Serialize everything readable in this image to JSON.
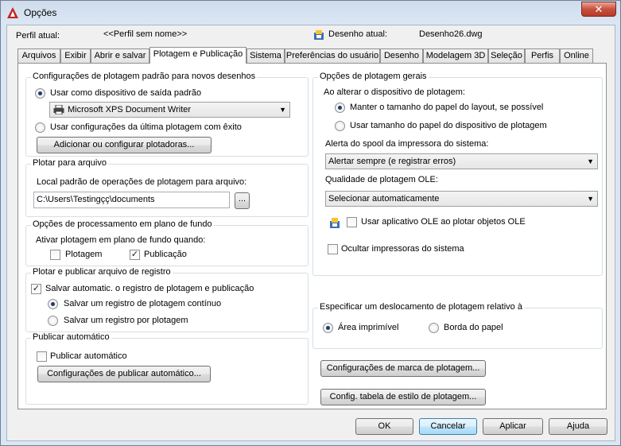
{
  "window": {
    "title": "Opções",
    "close_label": "✕"
  },
  "header": {
    "profile_label": "Perfil atual:",
    "profile_value": "<<Perfil sem nome>>",
    "drawing_label": "Desenho atual:",
    "drawing_value": "Desenho26.dwg"
  },
  "tabs": [
    {
      "label": "Arquivos"
    },
    {
      "label": "Exibir"
    },
    {
      "label": "Abrir e salvar"
    },
    {
      "label": "Plotagem e Publicação",
      "active": true
    },
    {
      "label": "Sistema"
    },
    {
      "label": "Preferências do usuário"
    },
    {
      "label": "Desenho"
    },
    {
      "label": "Modelagem 3D"
    },
    {
      "label": "Seleção"
    },
    {
      "label": "Perfis"
    },
    {
      "label": "Online"
    }
  ],
  "defaults": {
    "title": "Configurações de plotagem padrão para novos desenhos",
    "use_default_device": "Usar como dispositivo de saída padrão",
    "device_value": "Microsoft XPS Document Writer",
    "use_last_settings": "Usar configurações da última plotagem com êxito",
    "add_plotters_button": "Adicionar ou configurar plotadoras..."
  },
  "plot_to_file": {
    "title": "Plotar para arquivo",
    "location_label": "Local padrão de operações de plotagem para arquivo:",
    "location_value": "C:\\Users\\Testingçç\\documents",
    "browse_button": "..."
  },
  "background": {
    "title": "Opções de processamento em plano de fundo",
    "enable_label": "Ativar plotagem em plano de fundo quando:",
    "plotting": "Plotagem",
    "publishing": "Publicação"
  },
  "log": {
    "title": "Plotar e publicar arquivo de registro",
    "auto_save": "Salvar automatic. o registro de plotagem e publicação",
    "continuous": "Salvar um registro de plotagem contínuo",
    "per_plot": "Salvar um registro por plotagem"
  },
  "autopublish": {
    "title": "Publicar automático",
    "checkbox": "Publicar automático",
    "settings_button": "Configurações de publicar automático..."
  },
  "general": {
    "title": "Opções de plotagem gerais",
    "when_changing": "Ao alterar o dispositivo de plotagem:",
    "keep_layout_size": "Manter o tamanho do papel do layout, se possível",
    "use_device_size": "Usar tamanho do papel do dispositivo de plotagem",
    "spool_label": "Alerta do spool da impressora do sistema:",
    "spool_value": "Alertar sempre (e registrar erros)",
    "ole_label": "Qualidade de plotagem OLE:",
    "ole_value": "Selecionar automaticamente",
    "use_ole_app": "Usar aplicativo OLE ao plotar objetos OLE",
    "hide_printers": "Ocultar impressoras do sistema"
  },
  "offset": {
    "title": "Especificar um deslocamento de plotagem relativo à",
    "printable_area": "Área imprimível",
    "paper_edge": "Borda do papel"
  },
  "buttons": {
    "stamp": "Configurações de marca de plotagem...",
    "style_table": "Config. tabela de estilo de plotagem...",
    "ok": "OK",
    "cancel": "Cancelar",
    "apply": "Aplicar",
    "help": "Ajuda"
  },
  "colors": {
    "accent": "#1d3b6b",
    "title_bar": "#cfdcec",
    "close": "#c9503d"
  }
}
